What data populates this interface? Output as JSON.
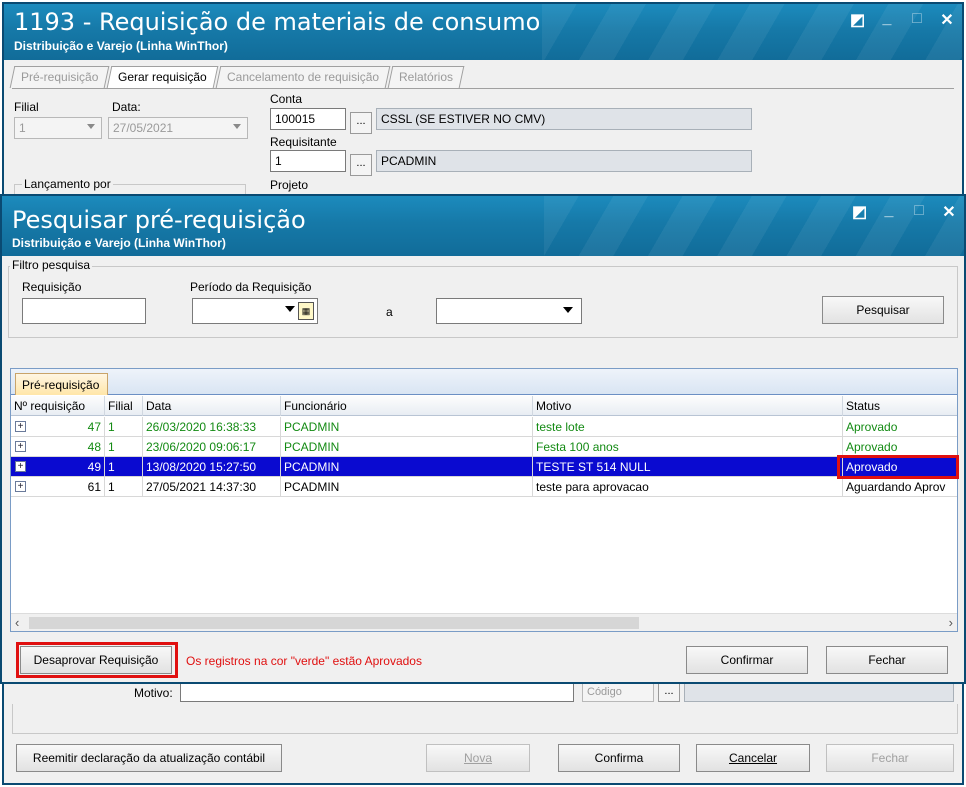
{
  "main_window": {
    "title": "1193 - Requisição de materiais de consumo",
    "subtitle": "Distribuição e Varejo (Linha WinThor)",
    "tabs": [
      "Pré-requisição",
      "Gerar requisição",
      "Cancelamento de requisição",
      "Relatórios"
    ],
    "filial_label": "Filial",
    "filial_value": "1",
    "data_label": "Data:",
    "data_value": "27/05/2021",
    "conta_label": "Conta",
    "conta_code": "100015",
    "conta_desc": "CSSL (SE ESTIVER NO CMV)",
    "requisitante_label": "Requisitante",
    "requisitante_code": "1",
    "requisitante_desc": "PCADMIN",
    "projeto_label": "Projeto",
    "lancamento_label": "Lançamento por",
    "motivo_label": "Motivo:",
    "codigo_label": "Código",
    "dots": "...",
    "buttons": {
      "reemitir": "Reemitir declaração da atualização contábil",
      "nova": "Nova",
      "confirma": "Confirma",
      "cancelar": "Cancelar",
      "fechar": "Fechar"
    }
  },
  "dialog": {
    "title": "Pesquisar pré-requisição",
    "subtitle": "Distribuição e Varejo (Linha WinThor)",
    "filtro_label": "Filtro pesquisa",
    "requisicao_label": "Requisição",
    "periodo_label": "Período da Requisição",
    "a_label": "a",
    "pesquisar": "Pesquisar",
    "grid_tab": "Pré-requisição",
    "columns": [
      "Nº requisição",
      "Filial",
      "Data",
      "Funcionário",
      "Motivo",
      "Status"
    ],
    "rows": [
      {
        "num": "47",
        "filial": "1",
        "data": "26/03/2020 16:38:33",
        "func": "PCADMIN",
        "motivo": "teste lote",
        "status": "Aprovado",
        "state": "green"
      },
      {
        "num": "48",
        "filial": "1",
        "data": "23/06/2020 09:06:17",
        "func": "PCADMIN",
        "motivo": "Festa 100 anos",
        "status": "Aprovado",
        "state": "green"
      },
      {
        "num": "49",
        "filial": "1",
        "data": "13/08/2020 15:27:50",
        "func": "PCADMIN",
        "motivo": "TESTE ST 514 NULL",
        "status": "Aprovado",
        "state": "selected"
      },
      {
        "num": "61",
        "filial": "1",
        "data": "27/05/2021 14:37:30",
        "func": "PCADMIN",
        "motivo": "teste para aprovacao",
        "status": "Aguardando Aprov",
        "state": "normal"
      }
    ],
    "desaprovar": "Desaprovar Requisição",
    "note": "Os registros na cor \"verde\" estão Aprovados",
    "confirmar": "Confirmar",
    "fechar": "Fechar"
  },
  "colors": {
    "title_blue": "#1679a8",
    "green_text": "#138a13",
    "selection": "#0a0ad0",
    "highlight_red": "#e01010",
    "note_red": "#e01010"
  }
}
